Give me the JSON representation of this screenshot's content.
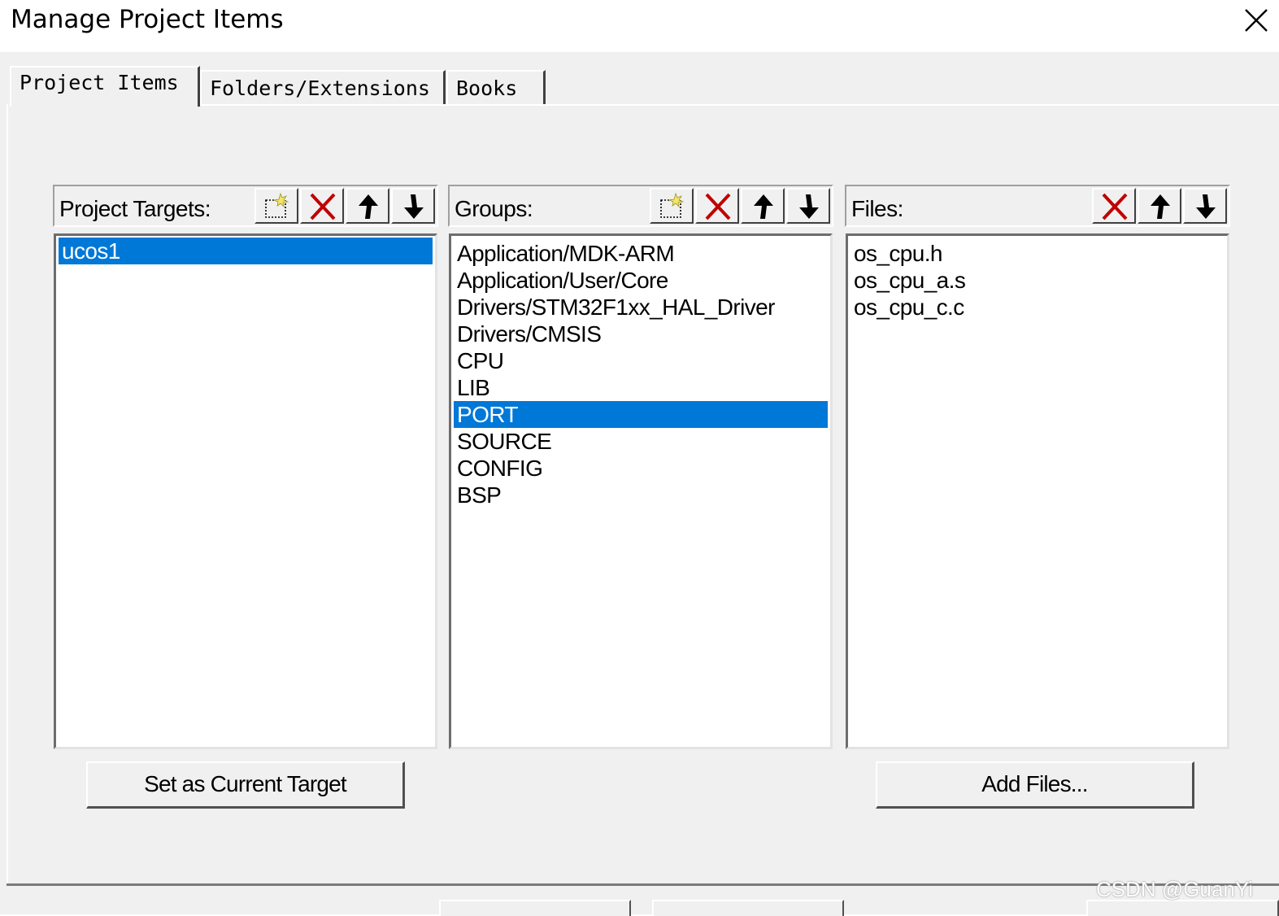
{
  "window": {
    "title": "Manage Project Items"
  },
  "tabs": [
    {
      "label": "Project Items",
      "active": true
    },
    {
      "label": "Folders/Extensions",
      "active": false
    },
    {
      "label": "Books",
      "active": false
    }
  ],
  "targets": {
    "label": "Project Targets:",
    "items": [
      {
        "text": "ucos1",
        "selected": true
      }
    ]
  },
  "groups": {
    "label": "Groups:",
    "items": [
      {
        "text": "Application/MDK-ARM",
        "selected": false
      },
      {
        "text": "Application/User/Core",
        "selected": false
      },
      {
        "text": "Drivers/STM32F1xx_HAL_Driver",
        "selected": false
      },
      {
        "text": "Drivers/CMSIS",
        "selected": false
      },
      {
        "text": "CPU",
        "selected": false
      },
      {
        "text": "LIB",
        "selected": false
      },
      {
        "text": "PORT",
        "selected": true
      },
      {
        "text": "SOURCE",
        "selected": false
      },
      {
        "text": "CONFIG",
        "selected": false
      },
      {
        "text": "BSP",
        "selected": false
      }
    ]
  },
  "files": {
    "label": "Files:",
    "items": [
      {
        "text": "os_cpu.h",
        "selected": false
      },
      {
        "text": "os_cpu_a.s",
        "selected": false
      },
      {
        "text": "os_cpu_c.c",
        "selected": false
      }
    ]
  },
  "buttons": {
    "set_current_target": "Set as Current Target",
    "add_files": "Add Files..."
  },
  "toolbar_icons": {
    "new": "new-item-icon",
    "delete": "delete-icon",
    "move_up": "move-up-icon",
    "move_down": "move-down-icon"
  },
  "colors": {
    "selection": "#0078d7",
    "delete_icon": "#c00000"
  },
  "watermark": "CSDN @GuanYi"
}
